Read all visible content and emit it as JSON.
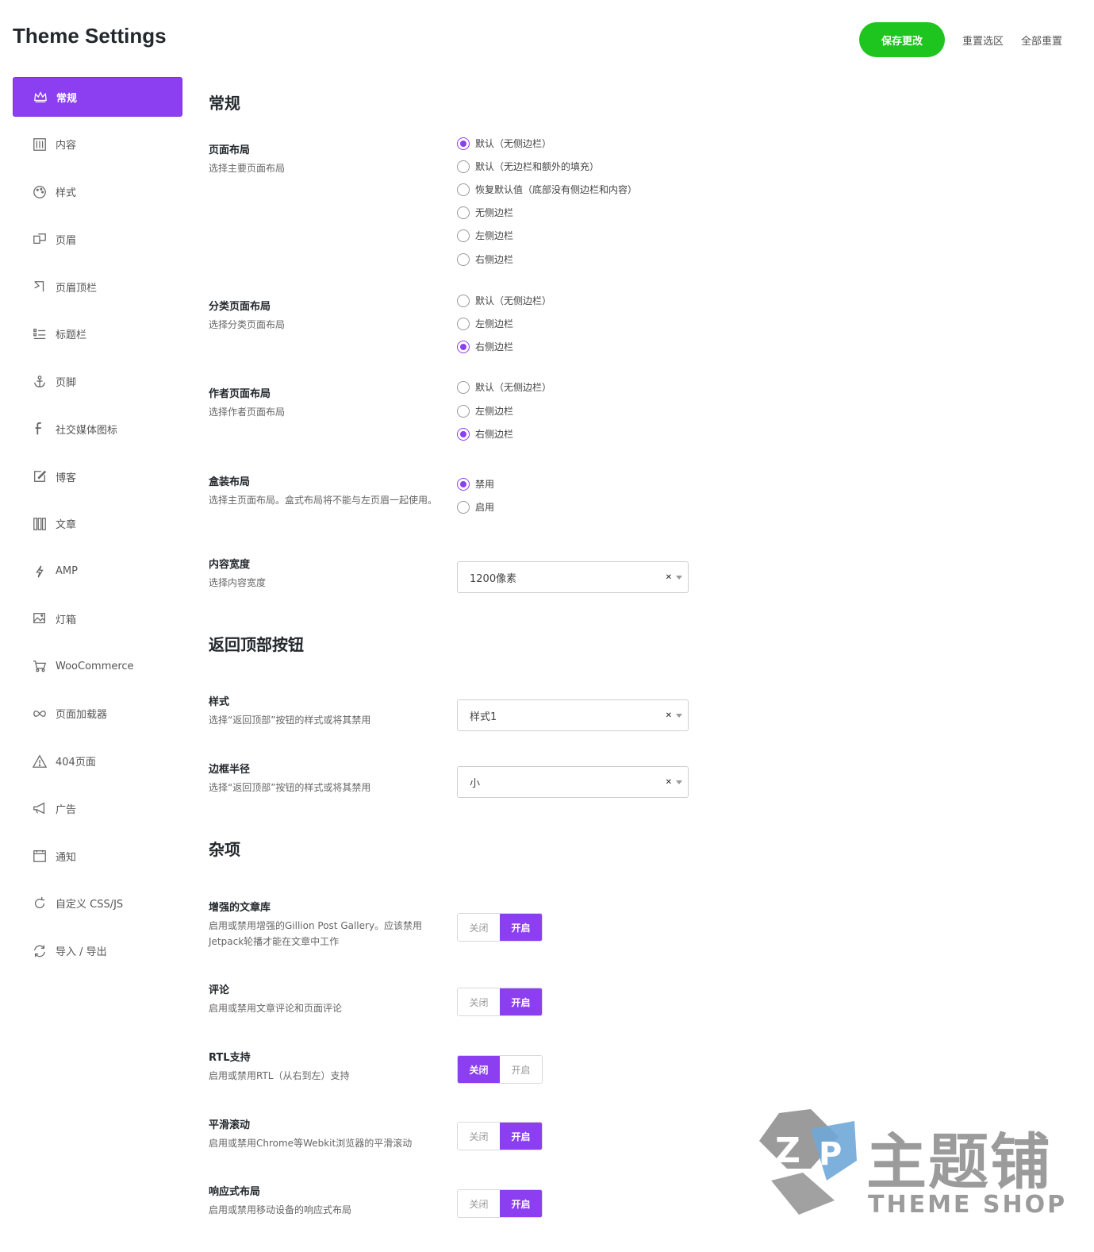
{
  "header": {
    "title": "Theme Settings",
    "save_label": "保存更改",
    "reset_section_label": "重置选区",
    "reset_all_label": "全部重置"
  },
  "colors": {
    "accent": "#8c3ff0",
    "save": "#1ec51e"
  },
  "sidebar": {
    "items": [
      {
        "label": "常规",
        "icon": "crown-icon"
      },
      {
        "label": "内容",
        "icon": "sliders-icon"
      },
      {
        "label": "样式",
        "icon": "palette-icon"
      },
      {
        "label": "页眉",
        "icon": "header-icon"
      },
      {
        "label": "页眉顶栏",
        "icon": "topbar-icon"
      },
      {
        "label": "标题栏",
        "icon": "list-icon"
      },
      {
        "label": "页脚",
        "icon": "anchor-icon"
      },
      {
        "label": "社交媒体图标",
        "icon": "facebook-icon"
      },
      {
        "label": "博客",
        "icon": "edit-icon"
      },
      {
        "label": "文章",
        "icon": "columns-icon"
      },
      {
        "label": "AMP",
        "icon": "bolt-icon"
      },
      {
        "label": "灯箱",
        "icon": "image-icon"
      },
      {
        "label": "WooCommerce",
        "icon": "cart-icon"
      },
      {
        "label": "页面加载器",
        "icon": "infinity-icon"
      },
      {
        "label": "404页面",
        "icon": "warning-icon"
      },
      {
        "label": "广告",
        "icon": "megaphone-icon"
      },
      {
        "label": "通知",
        "icon": "calendar-icon"
      },
      {
        "label": "自定义 CSS/JS",
        "icon": "refresh-icon"
      },
      {
        "label": "导入 / 导出",
        "icon": "sync-icon"
      }
    ]
  },
  "general": {
    "title": "常规",
    "page_layout": {
      "label": "页面布局",
      "desc": "选择主要页面布局",
      "options": [
        "默认（无侧边栏）",
        "默认（无边栏和额外的填充）",
        "恢复默认值（底部没有侧边栏和内容）",
        "无侧边栏",
        "左侧边栏",
        "右侧边栏"
      ],
      "selected": 0
    },
    "category_layout": {
      "label": "分类页面布局",
      "desc": "选择分类页面布局",
      "options": [
        "默认（无侧边栏）",
        "左侧边栏",
        "右侧边栏"
      ],
      "selected": 2
    },
    "author_layout": {
      "label": "作者页面布局",
      "desc": "选择作者页面布局",
      "options": [
        "默认（无侧边栏）",
        "左侧边栏",
        "右侧边栏"
      ],
      "selected": 2
    },
    "boxed_layout": {
      "label": "盒装布局",
      "desc": "选择主页面布局。盒式布局将不能与左页眉一起使用。",
      "options": [
        "禁用",
        "启用"
      ],
      "selected": 0
    },
    "content_width": {
      "label": "内容宽度",
      "desc": "选择内容宽度",
      "value": "1200像素"
    }
  },
  "back_to_top": {
    "title": "返回顶部按钮",
    "style": {
      "label": "样式",
      "desc": "选择“返回顶部”按钮的样式或将其禁用",
      "value": "样式1"
    },
    "radius": {
      "label": "边框半径",
      "desc": "选择“返回顶部”按钮的样式或将其禁用",
      "value": "小"
    }
  },
  "misc": {
    "title": "杂项",
    "off_label": "关闭",
    "on_label": "开启",
    "items": [
      {
        "label": "增强的文章库",
        "desc": "启用或禁用增强的Gillion Post Gallery。应该禁用Jetpack轮播才能在文章中工作",
        "enabled": true
      },
      {
        "label": "评论",
        "desc": "启用或禁用文章评论和页面评论",
        "enabled": true
      },
      {
        "label": "RTL支持",
        "desc": "启用或禁用RTL（从右到左）支持",
        "enabled": false
      },
      {
        "label": "平滑滚动",
        "desc": "启用或禁用Chrome等Webkit浏览器的平滑滚动",
        "enabled": true
      },
      {
        "label": "响应式布局",
        "desc": "启用或禁用移动设备的响应式布局",
        "enabled": true
      }
    ]
  },
  "watermark": {
    "text": "主题铺",
    "sub": "THEME SHOP"
  }
}
